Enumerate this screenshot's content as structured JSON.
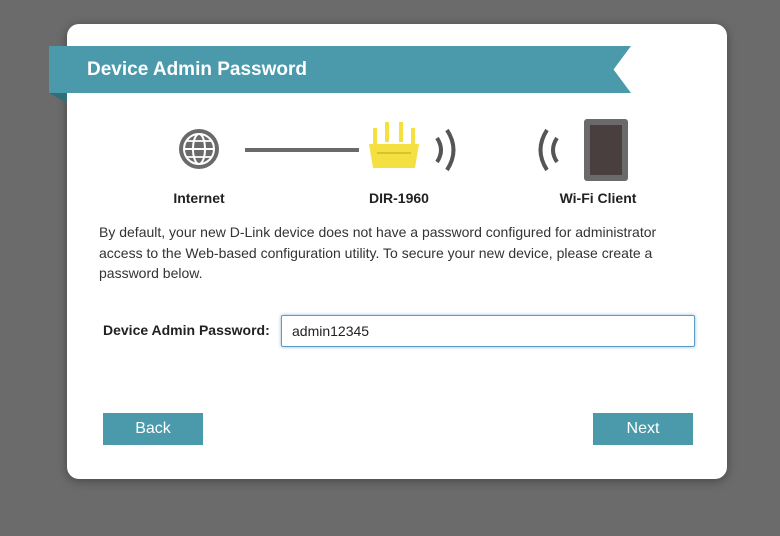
{
  "dialog": {
    "title": "Device Admin Password",
    "diagram": {
      "internet_label": "Internet",
      "router_label": "DIR-1960",
      "client_label": "Wi-Fi Client"
    },
    "description": "By default, your new D-Link device does not have a password configured for administrator access to the Web-based configuration utility. To secure your new device, please create a password below.",
    "password_label": "Device Admin Password:",
    "password_value": "admin12345",
    "back_label": "Back",
    "next_label": "Next"
  },
  "colors": {
    "accent": "#4a9aab",
    "router": "#f5e042",
    "backdrop": "#6b6b6b"
  },
  "icons": [
    "globe-icon",
    "router-icon",
    "wifi-signal-icon",
    "tablet-icon"
  ]
}
